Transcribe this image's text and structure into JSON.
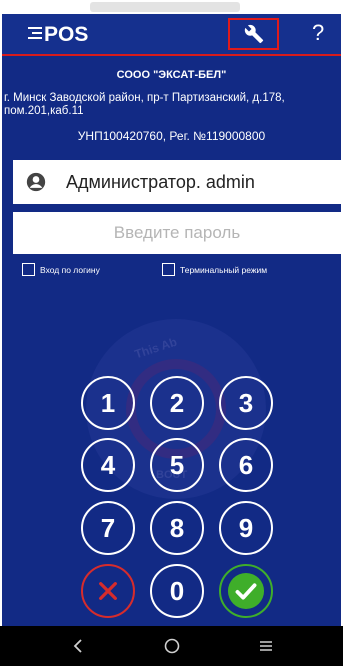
{
  "app": {
    "logo_text": "POS",
    "help_label": "?"
  },
  "company": {
    "name": "СООО \"ЭКСАТ-БЕЛ\"",
    "address": "г. Минск Заводской район, пр-т Партизанский, д.178, пом.201,каб.11",
    "reg": "УНП100420760, Рег. №119000800"
  },
  "login": {
    "user": "Администратор. admin",
    "password_placeholder": "Введите пароль",
    "login_by_username": "Вход по логину",
    "terminal_mode": "Терминальный режим"
  },
  "keypad": {
    "keys": [
      "1",
      "2",
      "3",
      "4",
      "5",
      "6",
      "7",
      "8",
      "9",
      "0"
    ]
  },
  "watermark": {
    "text_top": "This Ab",
    "text_bottom": "BOUT"
  },
  "colors": {
    "background": "#122a85",
    "accent_red": "#d81b1b",
    "cancel_red": "#d62c2c",
    "ok_green": "#3fae2a"
  }
}
